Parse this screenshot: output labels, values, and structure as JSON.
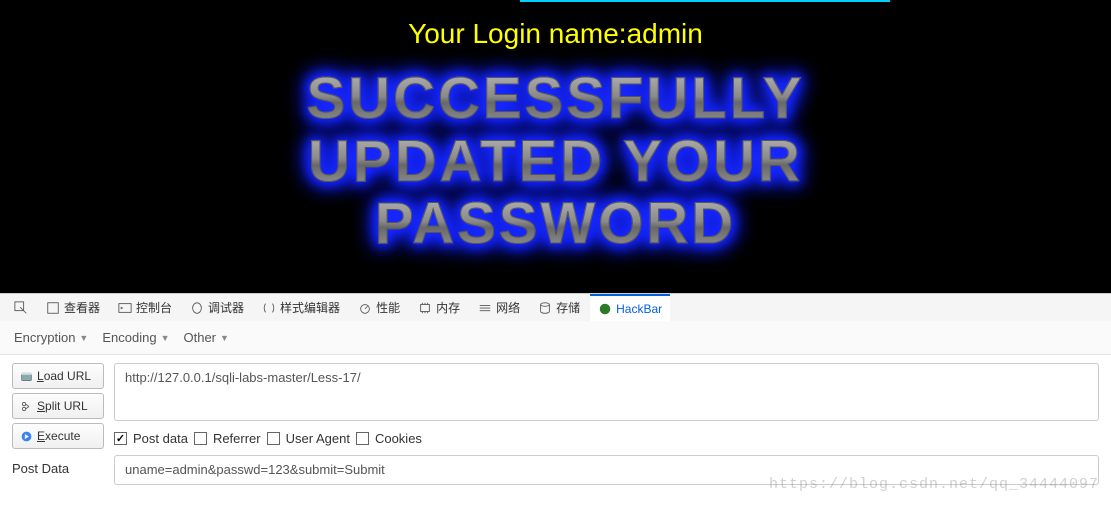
{
  "page": {
    "login_text": "Your Login name:admin",
    "success_line1": "SUCCESSFULLY",
    "success_line2": "UPDATED YOUR",
    "success_line3": "PASSWORD"
  },
  "devtools_tabs": {
    "inspector": "查看器",
    "console": "控制台",
    "debugger": "调试器",
    "style": "样式编辑器",
    "performance": "性能",
    "memory": "内存",
    "network": "网络",
    "storage": "存储",
    "hackbar": "HackBar"
  },
  "hackbar_toolbar": {
    "encryption": "Encryption",
    "encoding": "Encoding",
    "other": "Other"
  },
  "hackbar_buttons": {
    "load_prefix": "L",
    "load_rest": "oad URL",
    "split_prefix": "S",
    "split_rest": "plit URL",
    "execute_prefix": "E",
    "execute_rest": "xecute"
  },
  "url_value": "http://127.0.0.1/sqli-labs-master/Less-17/",
  "checkboxes": {
    "postdata": "Post data",
    "referrer": "Referrer",
    "useragent": "User Agent",
    "cookies": "Cookies"
  },
  "postdata": {
    "label": "Post Data",
    "value": "uname=admin&passwd=123&submit=Submit"
  },
  "watermark": "https://blog.csdn.net/qq_34444097"
}
